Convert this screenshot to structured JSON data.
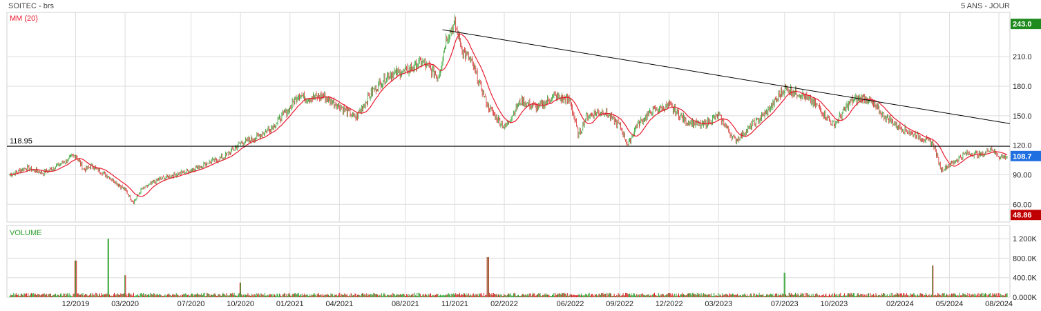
{
  "header": {
    "title": "SOITEC - brs",
    "period": "5 ANS - JOUR"
  },
  "chart_data": [
    {
      "type": "candlestick",
      "indicator_label": "MM (20)",
      "y_ticks": [
        "60.00",
        "90.00",
        "120.0",
        "150.0",
        "180.0",
        "210.0"
      ],
      "ylim": [
        42,
        255
      ],
      "x_ticks": [
        "12/2019",
        "03/2020",
        "07/2020",
        "10/2020",
        "01/2021",
        "04/2021",
        "08/2021",
        "11/2021",
        "02/2022",
        "06/2022",
        "09/2022",
        "12/2022",
        "03/2023",
        "07/2023",
        "10/2023",
        "02/2024",
        "05/2024",
        "08/2024"
      ],
      "badges": {
        "high": "243.0",
        "last": "108.7",
        "low": "48.86"
      },
      "support_line": {
        "label": "118.95",
        "value": 118.95
      },
      "trendline": {
        "start": {
          "x": "10/2021",
          "y": 243.0
        },
        "end": {
          "x": "08/2024",
          "y": 142.0
        }
      },
      "close_path": [
        [
          "08/2019",
          90
        ],
        [
          "09/2019",
          97
        ],
        [
          "10/2019",
          92
        ],
        [
          "11/2019",
          100
        ],
        [
          "12/2019",
          110
        ],
        [
          "12/2019",
          95
        ],
        [
          "01/2020",
          99
        ],
        [
          "02/2020",
          88
        ],
        [
          "03/2020",
          75
        ],
        [
          "03/2020",
          62
        ],
        [
          "04/2020",
          75
        ],
        [
          "05/2020",
          85
        ],
        [
          "06/2020",
          90
        ],
        [
          "07/2020",
          95
        ],
        [
          "08/2020",
          102
        ],
        [
          "09/2020",
          108
        ],
        [
          "10/2020",
          122
        ],
        [
          "11/2020",
          128
        ],
        [
          "12/2020",
          140
        ],
        [
          "01/2021",
          158
        ],
        [
          "01/2021",
          172
        ],
        [
          "02/2021",
          168
        ],
        [
          "03/2021",
          170
        ],
        [
          "04/2021",
          160
        ],
        [
          "05/2021",
          148
        ],
        [
          "06/2021",
          175
        ],
        [
          "07/2021",
          192
        ],
        [
          "08/2021",
          195
        ],
        [
          "09/2021",
          205
        ],
        [
          "10/2021",
          190
        ],
        [
          "10/2021",
          230
        ],
        [
          "11/2021",
          243
        ],
        [
          "11/2021",
          215
        ],
        [
          "12/2021",
          205
        ],
        [
          "01/2022",
          160
        ],
        [
          "02/2022",
          138
        ],
        [
          "03/2022",
          165
        ],
        [
          "04/2022",
          158
        ],
        [
          "05/2022",
          170
        ],
        [
          "06/2022",
          165
        ],
        [
          "06/2022",
          130
        ],
        [
          "07/2022",
          150
        ],
        [
          "08/2022",
          155
        ],
        [
          "09/2022",
          140
        ],
        [
          "09/2022",
          120
        ],
        [
          "10/2022",
          140
        ],
        [
          "11/2022",
          155
        ],
        [
          "12/2022",
          160
        ],
        [
          "01/2023",
          145
        ],
        [
          "02/2023",
          140
        ],
        [
          "03/2023",
          150
        ],
        [
          "04/2023",
          125
        ],
        [
          "05/2023",
          140
        ],
        [
          "06/2023",
          155
        ],
        [
          "07/2023",
          178
        ],
        [
          "08/2023",
          172
        ],
        [
          "09/2023",
          160
        ],
        [
          "10/2023",
          140
        ],
        [
          "11/2023",
          165
        ],
        [
          "12/2023",
          168
        ],
        [
          "01/2024",
          150
        ],
        [
          "02/2024",
          138
        ],
        [
          "03/2024",
          130
        ],
        [
          "04/2024",
          122
        ],
        [
          "04/2024",
          95
        ],
        [
          "05/2024",
          100
        ],
        [
          "06/2024",
          112
        ],
        [
          "07/2024",
          110
        ],
        [
          "07/2024",
          118
        ],
        [
          "08/2024",
          108.7
        ]
      ]
    },
    {
      "type": "bar",
      "series_label": "VOLUME",
      "y_ticks": [
        "0.000K",
        "400.0K",
        "800.0K",
        "1 200K"
      ],
      "ylim": [
        0,
        1300000
      ],
      "x_ticks": [
        "12/2019",
        "03/2020",
        "07/2020",
        "10/2020",
        "01/2021",
        "04/2021",
        "08/2021",
        "11/2021",
        "02/2022",
        "06/2022",
        "09/2022",
        "12/2022",
        "03/2023",
        "07/2023",
        "10/2023",
        "02/2024",
        "05/2024",
        "08/2024"
      ],
      "spikes": [
        [
          "12/2019",
          750000
        ],
        [
          "02/2020",
          1200000
        ],
        [
          "03/2020",
          450000
        ],
        [
          "10/2020",
          300000
        ],
        [
          "01/2022",
          820000
        ],
        [
          "07/2023",
          500000
        ],
        [
          "04/2024",
          650000
        ]
      ]
    }
  ],
  "colors": {
    "up": "#2ca02c",
    "down": "#d62728",
    "ma": "#e8192c",
    "high_badge": "#1f8b1f",
    "last_badge": "#1f6fe0",
    "low_badge": "#c00000"
  }
}
